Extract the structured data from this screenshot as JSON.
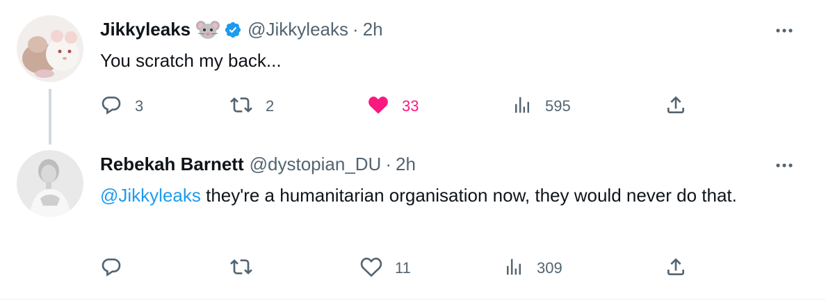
{
  "tweets": [
    {
      "name": "Jikkyleaks",
      "handle": "@Jikkyleaks",
      "dot": "·",
      "time": "2h",
      "text": "You scratch my back...",
      "actions": {
        "replies": "3",
        "retweets": "2",
        "likes": "33",
        "views": "595"
      },
      "liked": true,
      "verified": true,
      "emoji": "mouse-face"
    },
    {
      "name": "Rebekah Barnett",
      "handle": "@dystopian_DU",
      "dot": "·",
      "time": "2h",
      "mention": "@Jikkyleaks",
      "text": " they're a humanitarian organisation now, they would never do that.",
      "actions": {
        "replies": "",
        "retweets": "",
        "likes": "11",
        "views": "309"
      },
      "liked": false
    }
  ],
  "colors": {
    "accent": "#1d9bf0",
    "like": "#f91880",
    "secondary": "#536471",
    "thread_line": "#cfd9de"
  }
}
